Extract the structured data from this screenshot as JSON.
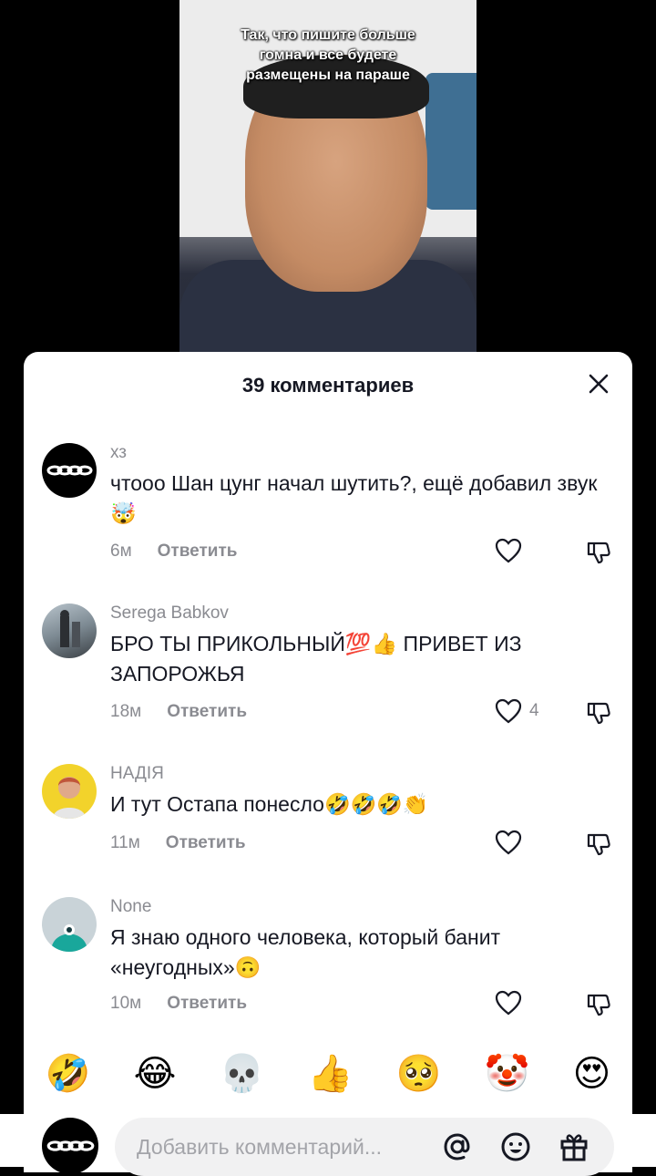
{
  "video": {
    "caption_lines": [
      "Так, что пишите больше",
      "гомна и все будете",
      "размещены на параше"
    ]
  },
  "sheet": {
    "title": "39 комментариев",
    "close_icon": "close-icon"
  },
  "comments": [
    {
      "username": "хз",
      "text": "чтооо Шан цунг начал шутить?, ещё добавил звук🤯",
      "time": "6м",
      "reply_label": "Ответить",
      "likes": "",
      "avatar": "chain-avatar"
    },
    {
      "username": "Serega Babkov",
      "text": "БРО ТЫ ПРИКОЛЬНЫЙ💯👍 ПРИВЕТ ИЗ ЗАПОРОЖЬЯ",
      "time": "18м",
      "reply_label": "Ответить",
      "likes": "4",
      "avatar": "photo-avatar"
    },
    {
      "username": "НАДІЯ",
      "text": "И тут Остапа понесло🤣🤣🤣👏",
      "time": "11м",
      "reply_label": "Ответить",
      "likes": "",
      "avatar": "photo-avatar"
    },
    {
      "username": "None",
      "text": "Я знаю одного человека, который банит «неугодных»🙃",
      "time": "10м",
      "reply_label": "Ответить",
      "likes": "",
      "avatar": "cartoon-avatar"
    }
  ],
  "emoji_bar": [
    "🤣",
    "😂",
    "💀",
    "👍",
    "🥺",
    "🤡",
    "😍"
  ],
  "input": {
    "placeholder": "Добавить комментарий...",
    "icons": [
      "at-icon",
      "emoji-icon",
      "gift-icon"
    ]
  },
  "colors": {
    "text_primary": "#161823",
    "text_secondary": "#8a8b91",
    "input_bg": "#f1f1f2"
  }
}
